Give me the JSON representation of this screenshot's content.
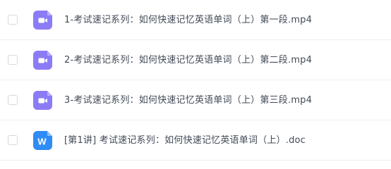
{
  "files": [
    {
      "name": "1-考试速记系列：如何快速记忆英语单词（上）第一段.mp4",
      "type": "video",
      "icon": "video-file-icon"
    },
    {
      "name": "2-考试速记系列：如何快速记忆英语单词（上）第二段.mp4",
      "type": "video",
      "icon": "video-file-icon"
    },
    {
      "name": "3-考试速记系列：如何快速记忆英语单词（上）第三段.mp4",
      "type": "video",
      "icon": "video-file-icon"
    },
    {
      "name": "[第1讲] 考试速记系列：如何快速记忆英语单词（上）.doc",
      "type": "word",
      "icon": "word-file-icon",
      "icon_letter": "W"
    }
  ],
  "colors": {
    "video_icon_bg": "#8b7cf6",
    "word_icon_bg": "#2f8bf5",
    "text": "#424a57",
    "divider": "#eef0f4"
  }
}
